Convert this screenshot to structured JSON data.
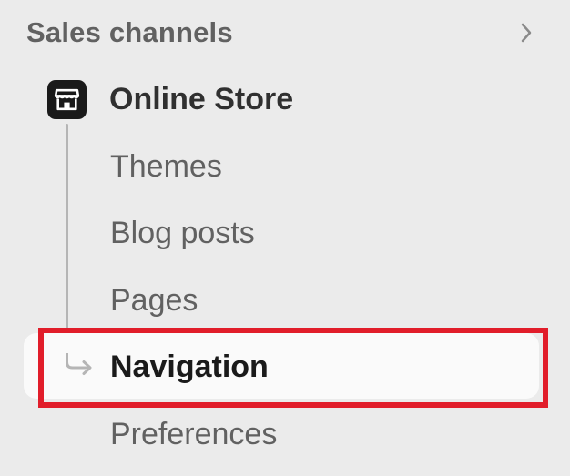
{
  "sales_channels": {
    "title": "Sales channels",
    "expand_icon": "chevron-right-icon"
  },
  "online_store": {
    "label": "Online Store",
    "icon": "store-icon",
    "items": [
      {
        "label": "Themes"
      },
      {
        "label": "Blog posts"
      },
      {
        "label": "Pages"
      },
      {
        "label": "Navigation",
        "active": true,
        "icon": "arrow-branch-icon"
      },
      {
        "label": "Preferences"
      }
    ]
  },
  "colors": {
    "background": "#ebebeb",
    "active_row": "#fafafa",
    "highlight_border": "#e11d2a",
    "text_primary": "#1a1a1a",
    "text_secondary": "#616161"
  }
}
